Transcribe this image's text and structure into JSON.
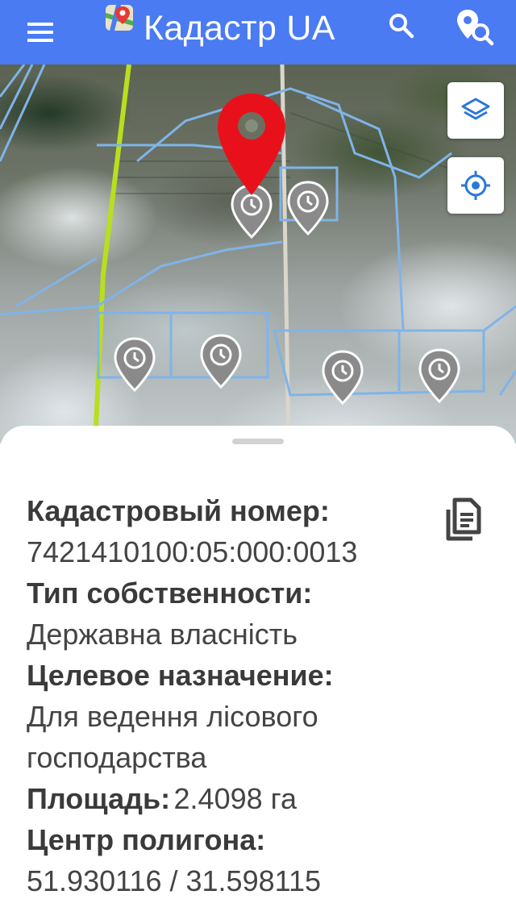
{
  "appbar": {
    "title": "Кадастр UA",
    "menu_icon": "menu-icon",
    "logo_icon": "map-logo-icon",
    "search_icon": "search-icon",
    "geo_search_icon": "location-search-icon",
    "color": "#4a7bf2"
  },
  "map": {
    "layers_icon": "layers-icon",
    "locate_icon": "crosshair-icon",
    "selected_marker_color": "#e8111b",
    "history_marker_color": "#8a8a8a",
    "parcel_outline_color": "#7fb4e8",
    "boundary_line_color": "#b8df1e"
  },
  "parcel": {
    "cadastral_label": "Кадастровый номер:",
    "cadastral_value": "7421410100:05:000:0013",
    "ownership_label": "Тип собственности:",
    "ownership_value": "Державна власність",
    "purpose_label": "Целевое назначение:",
    "purpose_value": "Для ведення лісового господарства",
    "area_label": "Площадь:",
    "area_value": "2.4098 га",
    "center_label": "Центр полигона:",
    "center_value": "51.930116 / 31.598115",
    "copy_icon": "document-icon"
  }
}
